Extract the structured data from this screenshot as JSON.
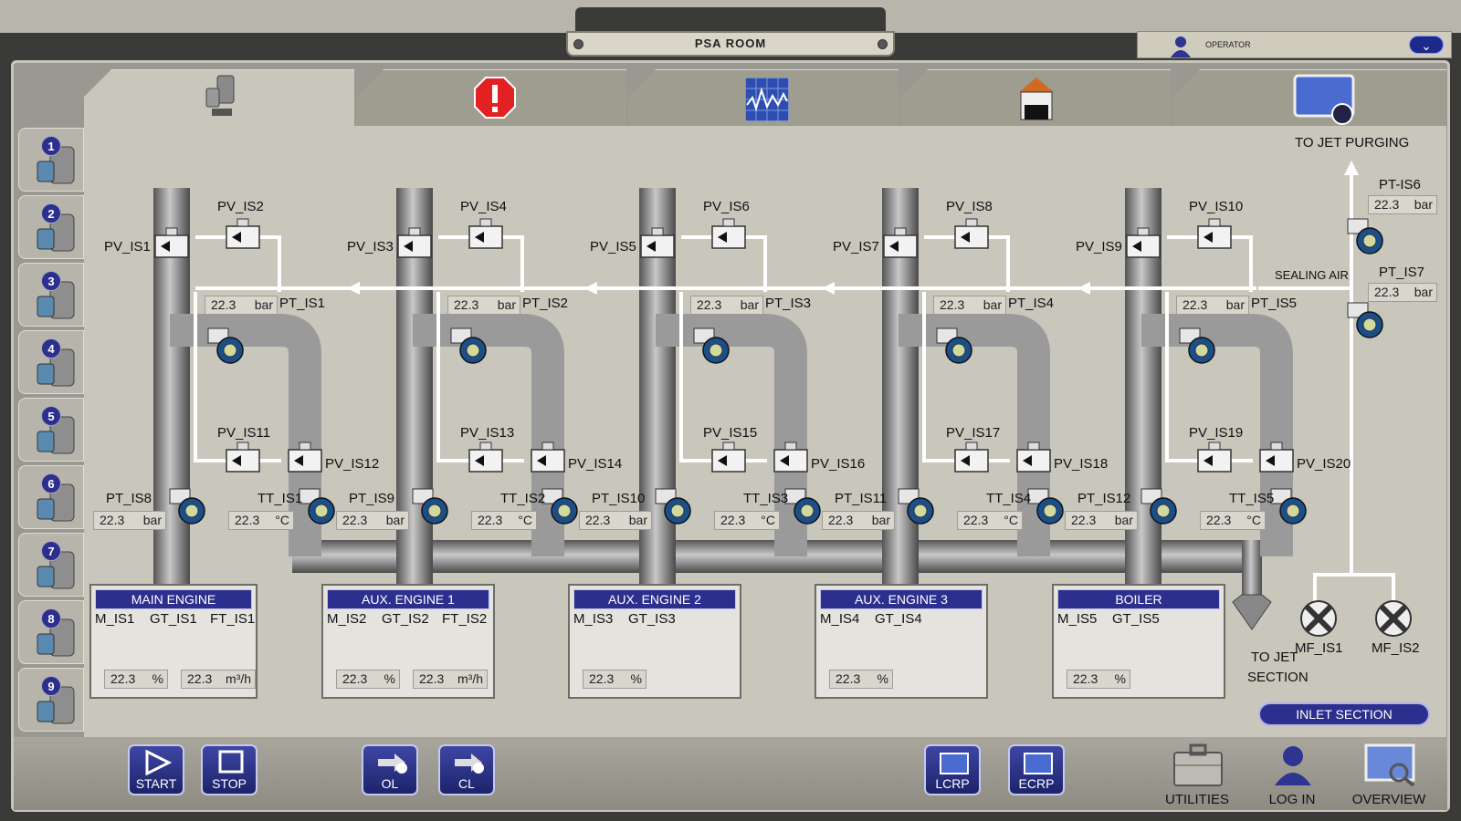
{
  "window": {
    "title": "PSA ROOM",
    "user_label": "OPERATOR"
  },
  "tabs": [
    {
      "name": "tab-compressor",
      "icon": "compressor-icon"
    },
    {
      "name": "tab-alarm",
      "icon": "alarm-icon"
    },
    {
      "name": "tab-trend",
      "icon": "trend-chart-icon"
    },
    {
      "name": "tab-building",
      "icon": "building-icon"
    },
    {
      "name": "tab-settings",
      "icon": "screen-settings-icon"
    }
  ],
  "sidebar": [
    {
      "num": "1",
      "icon": "compressor-icon"
    },
    {
      "num": "2",
      "icon": "compressor-icon"
    },
    {
      "num": "3",
      "icon": "compressor-icon"
    },
    {
      "num": "4",
      "icon": "compressor-icon"
    },
    {
      "num": "5",
      "icon": "motor-icon"
    },
    {
      "num": "6",
      "icon": "motor-cycle-icon"
    },
    {
      "num": "7",
      "icon": "filter-icon"
    },
    {
      "num": "8",
      "icon": "tank-icon"
    },
    {
      "num": "9",
      "icon": "pump-icon"
    }
  ],
  "labels": {
    "to_jet_purging": "TO JET PURGING",
    "sealing_air": "SEALING AIR",
    "to_jet_section_1": "TO JET",
    "to_jet_section_2": "SECTION",
    "mf_is1": "MF_IS1",
    "mf_is2": "MF_IS2",
    "pt_is6": "PT-IS6",
    "pt_is7": "PT_IS7",
    "inlet_section": "INLET SECTION"
  },
  "right_readings": [
    {
      "value": "22.3",
      "unit": "bar"
    },
    {
      "value": "22.3",
      "unit": "bar"
    }
  ],
  "units": [
    {
      "pv_a": "PV_IS1",
      "pv_b": "PV_IS2",
      "pv_c": "PV_IS11",
      "pv_d": "PV_IS12",
      "pt_top": "PT_IS1",
      "pt_top_value": "22.3",
      "pt_top_unit": "bar",
      "pt_bot": "PT_IS8",
      "pt_bot_value": "22.3",
      "pt_bot_unit": "bar",
      "tt": "TT_IS1",
      "tt_value": "22.3",
      "tt_unit": "°C"
    },
    {
      "pv_a": "PV_IS3",
      "pv_b": "PV_IS4",
      "pv_c": "PV_IS13",
      "pv_d": "PV_IS14",
      "pt_top": "PT_IS2",
      "pt_top_value": "22.3",
      "pt_top_unit": "bar",
      "pt_bot": "PT_IS9",
      "pt_bot_value": "22.3",
      "pt_bot_unit": "bar",
      "tt": "TT_IS2",
      "tt_value": "22.3",
      "tt_unit": "°C"
    },
    {
      "pv_a": "PV_IS5",
      "pv_b": "PV_IS6",
      "pv_c": "PV_IS15",
      "pv_d": "PV_IS16",
      "pt_top": "PT_IS3",
      "pt_top_value": "22.3",
      "pt_top_unit": "bar",
      "pt_bot": "PT_IS10",
      "pt_bot_value": "22.3",
      "pt_bot_unit": "bar",
      "tt": "TT_IS3",
      "tt_value": "22.3",
      "tt_unit": "°C"
    },
    {
      "pv_a": "PV_IS7",
      "pv_b": "PV_IS8",
      "pv_c": "PV_IS17",
      "pv_d": "PV_IS18",
      "pt_top": "PT_IS4",
      "pt_top_value": "22.3",
      "pt_top_unit": "bar",
      "pt_bot": "PT_IS11",
      "pt_bot_value": "22.3",
      "pt_bot_unit": "bar",
      "tt": "TT_IS4",
      "tt_value": "22.3",
      "tt_unit": "°C"
    },
    {
      "pv_a": "PV_IS9",
      "pv_b": "PV_IS10",
      "pv_c": "PV_IS19",
      "pv_d": "PV_IS20",
      "pt_top": "PT_IS5",
      "pt_top_value": "22.3",
      "pt_top_unit": "bar",
      "pt_bot": "PT_IS12",
      "pt_bot_value": "22.3",
      "pt_bot_unit": "bar",
      "tt": "TT_IS5",
      "tt_value": "22.3",
      "tt_unit": "°C"
    }
  ],
  "panels": [
    {
      "title": "MAIN ENGINE",
      "m": "M_IS1",
      "gt": "GT_IS1",
      "ft": "FT_IS1",
      "pct_value": "22.3",
      "pct_unit": "%",
      "flow_value": "22.3",
      "flow_unit": "m³/h"
    },
    {
      "title": "AUX. ENGINE 1",
      "m": "M_IS2",
      "gt": "GT_IS2",
      "ft": "FT_IS2",
      "pct_value": "22.3",
      "pct_unit": "%",
      "flow_value": "22.3",
      "flow_unit": "m³/h"
    },
    {
      "title": "AUX. ENGINE 2",
      "m": "M_IS3",
      "gt": "GT_IS3",
      "pct_value": "22.3",
      "pct_unit": "%"
    },
    {
      "title": "AUX. ENGINE 3",
      "m": "M_IS4",
      "gt": "GT_IS4",
      "pct_value": "22.3",
      "pct_unit": "%"
    },
    {
      "title": "BOILER",
      "m": "M_IS5",
      "gt": "GT_IS5",
      "pct_value": "22.3",
      "pct_unit": "%"
    }
  ],
  "bottom": {
    "start": "START",
    "stop": "STOP",
    "ol": "OL",
    "cl": "CL",
    "lcrp": "LCRP",
    "ecrp": "ECRP",
    "utilities": "UTILITIES",
    "login": "LOG IN",
    "overview": "OVERVIEW"
  },
  "colors": {
    "accent": "#2d2f8e",
    "pipe": "#8a8a8a",
    "background": "#c9c6bc",
    "alarm": "#e22222"
  }
}
